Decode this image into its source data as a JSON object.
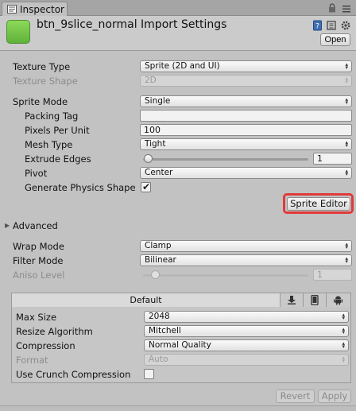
{
  "tab": {
    "label": "Inspector",
    "icon": "inspector-icon"
  },
  "header": {
    "title": "btn_9slice_normal Import Settings",
    "open_label": "Open"
  },
  "texture": {
    "type_label": "Texture Type",
    "type_value": "Sprite (2D and UI)",
    "shape_label": "Texture Shape",
    "shape_value": "2D"
  },
  "sprite": {
    "mode_label": "Sprite Mode",
    "mode_value": "Single",
    "packing_tag_label": "Packing Tag",
    "packing_tag_value": "",
    "ppu_label": "Pixels Per Unit",
    "ppu_value": "100",
    "mesh_type_label": "Mesh Type",
    "mesh_type_value": "Tight",
    "extrude_label": "Extrude Edges",
    "extrude_value": "1",
    "extrude_fraction": 0.03,
    "pivot_label": "Pivot",
    "pivot_value": "Center",
    "physics_label": "Generate Physics Shape",
    "physics_checked": true,
    "sprite_editor_label": "Sprite Editor"
  },
  "advanced": {
    "label": "Advanced",
    "expanded": false
  },
  "wrap": {
    "label": "Wrap Mode",
    "value": "Clamp"
  },
  "filter": {
    "label": "Filter Mode",
    "value": "Bilinear"
  },
  "aniso": {
    "label": "Aniso Level",
    "value": "1",
    "fraction": 0.07
  },
  "platform": {
    "default_tab": "Default",
    "tabs": [
      "download-icon",
      "mobile-icon",
      "android-icon"
    ],
    "max_size_label": "Max Size",
    "max_size_value": "2048",
    "resize_label": "Resize Algorithm",
    "resize_value": "Mitchell",
    "compression_label": "Compression",
    "compression_value": "Normal Quality",
    "format_label": "Format",
    "format_value": "Auto",
    "crunch_label": "Use Crunch Compression",
    "crunch_checked": false
  },
  "footer": {
    "revert_label": "Revert",
    "apply_label": "Apply"
  },
  "colors": {
    "highlight": "#e03a3a",
    "background": "#c2c2c2"
  }
}
